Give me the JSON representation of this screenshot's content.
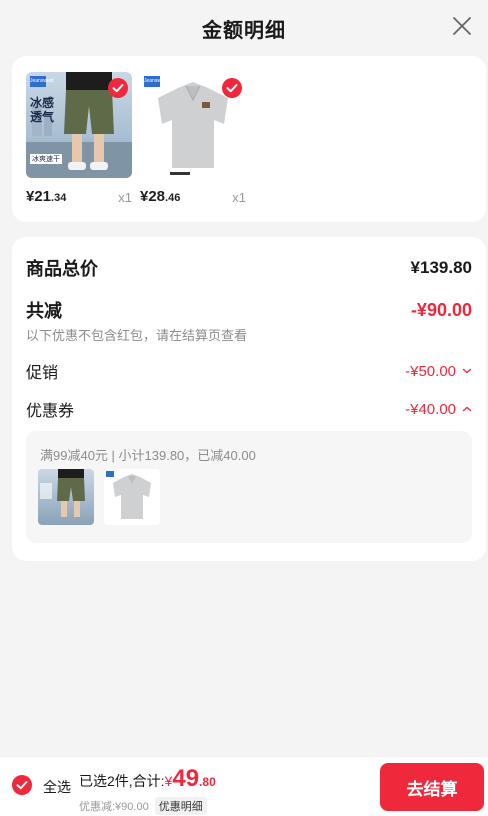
{
  "header": {
    "title": "金额明细"
  },
  "products": [
    {
      "brand": "Jeanswest",
      "tagline": "冰感透气",
      "sub": "冰爽速干",
      "yen": "¥",
      "price_int": "21",
      "price_dec": ".34",
      "qty": "x1"
    },
    {
      "brand": "Jeanswest",
      "yen": "¥",
      "price_int": "28",
      "price_dec": ".46",
      "qty": "x1"
    }
  ],
  "summary": {
    "total_label": "商品总价",
    "total_value": "¥139.80",
    "reduce_label": "共减",
    "reduce_value": "-¥90.00",
    "note": "以下优惠不包含红包，请在结算页查看",
    "promo_label": "促销",
    "promo_value": "-¥50.00",
    "coupon_label": "优惠券",
    "coupon_value": "-¥40.00",
    "coupon_detail": "满99减40元 | 小计139.80，已减40.00"
  },
  "bottom": {
    "select_all": "全选",
    "selected_text": "已选2件,合计:",
    "yen": "¥",
    "amount_int": "49",
    "amount_dec": ".80",
    "discount_text": "优惠减:¥90.00",
    "detail_tag": "优惠明细",
    "checkout": "去结算"
  },
  "colors": {
    "accent": "#f0283c",
    "background": "#f4f4f4"
  }
}
